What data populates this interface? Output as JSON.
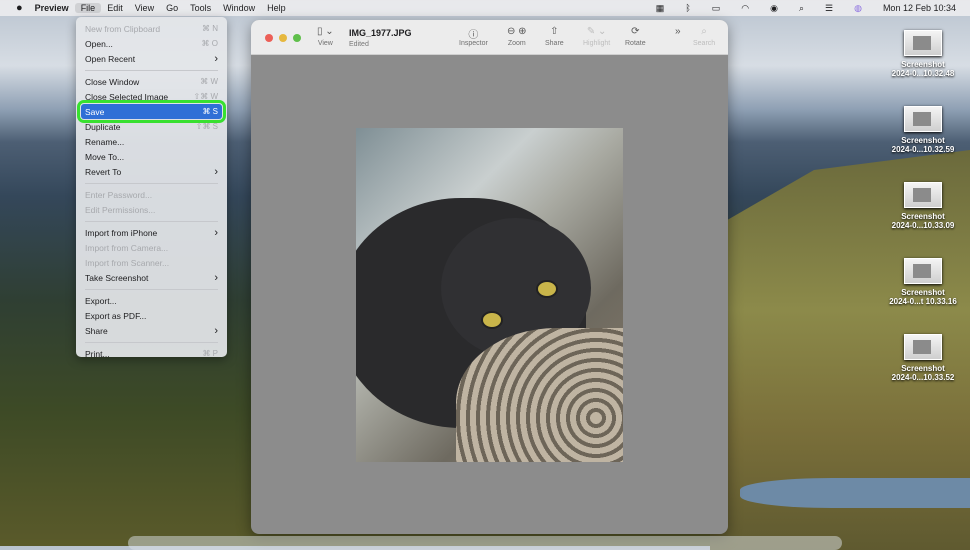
{
  "menubar": {
    "apple": "",
    "app": "Preview",
    "items": [
      "File",
      "Edit",
      "View",
      "Go",
      "Tools",
      "Window",
      "Help"
    ],
    "datetime": "Mon 12 Feb  10:34"
  },
  "file_menu": [
    {
      "label": "New from Clipboard",
      "shortcut": "⌘ N",
      "disabled": true
    },
    {
      "label": "Open...",
      "shortcut": "⌘ O"
    },
    {
      "label": "Open Recent",
      "submenu": true
    },
    {
      "sep": true
    },
    {
      "label": "Close Window",
      "shortcut": "⌘ W"
    },
    {
      "label": "Close Selected Image",
      "shortcut": "⇧⌘ W"
    },
    {
      "label": "Save",
      "shortcut": "⌘ S",
      "selected": true
    },
    {
      "label": "Duplicate",
      "shortcut": "⇧⌘ S"
    },
    {
      "label": "Rename..."
    },
    {
      "label": "Move To..."
    },
    {
      "label": "Revert To",
      "submenu": true
    },
    {
      "sep": true
    },
    {
      "label": "Enter Password...",
      "disabled": true
    },
    {
      "label": "Edit Permissions...",
      "disabled": true
    },
    {
      "sep": true
    },
    {
      "label": "Import from iPhone",
      "submenu": true
    },
    {
      "label": "Import from Camera...",
      "disabled": true
    },
    {
      "label": "Import from Scanner...",
      "disabled": true
    },
    {
      "label": "Take Screenshot",
      "submenu": true
    },
    {
      "sep": true
    },
    {
      "label": "Export..."
    },
    {
      "label": "Export as PDF..."
    },
    {
      "label": "Share",
      "submenu": true
    },
    {
      "sep": true
    },
    {
      "label": "Print...",
      "shortcut": "⌘ P"
    }
  ],
  "window": {
    "filename": "IMG_1977.JPG",
    "status": "Edited",
    "toolbar": {
      "view": "View",
      "inspector": "Inspector",
      "zoom": "Zoom",
      "share": "Share",
      "highlight": "Highlight",
      "rotate": "Rotate",
      "search": "Search"
    }
  },
  "desktop": [
    {
      "line1": "Screenshot",
      "line2": "2024-0...10.32.48"
    },
    {
      "line1": "Screenshot",
      "line2": "2024-0...10.32.59"
    },
    {
      "line1": "Screenshot",
      "line2": "2024-0...10.33.09"
    },
    {
      "line1": "Screenshot",
      "line2": "2024-0...t 10.33.16"
    },
    {
      "line1": "Screenshot",
      "line2": "2024-0...10.33.52"
    }
  ]
}
